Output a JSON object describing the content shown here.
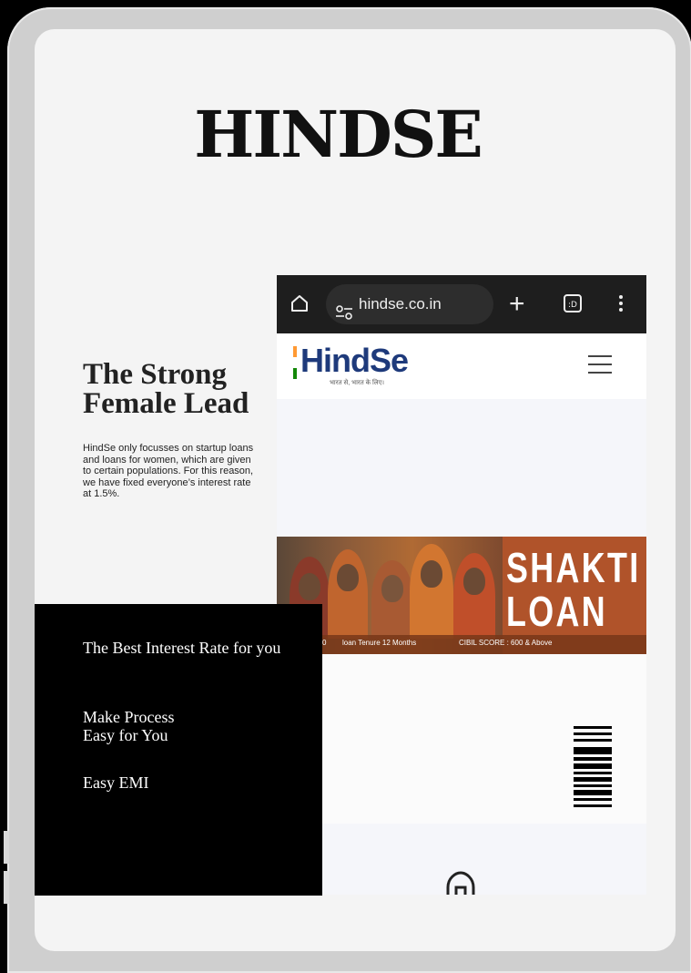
{
  "brand": {
    "title": "HINDSE"
  },
  "hero": {
    "headline_line1": "The Strong",
    "headline_line2": "Female Lead",
    "description": "HindSe only focusses on startup loans and loans for women, which are given to certain populations. For this reason, we have fixed everyone’s interest rate at 1.5%."
  },
  "features": {
    "item1": "The Best Interest Rate for you",
    "item2_line1": "Make Process",
    "item2_line2": "Easy for You",
    "item3": "Easy EMI"
  },
  "browser": {
    "url": "hindse.co.in",
    "icons": [
      "home-icon",
      "tune-icon",
      "plus-icon",
      "tab-switcher-icon",
      "more-vert-icon"
    ]
  },
  "site": {
    "logo_text": "HindSe",
    "logo_tagline": "भारत से, भारत के लिए।",
    "menu_icon": "hamburger-icon"
  },
  "banner": {
    "title_line1": "SHAKTI",
    "title_line2": "LOAN",
    "strip_items": [
      "0",
      "loan Tenure 12 Months",
      "CIBIL SCORE : 600 & Above"
    ]
  },
  "colors": {
    "background": "#000000",
    "tablet_frame": "#cfcfcf",
    "screen": "#f4f4f4",
    "browser_bar": "#1e1e1e",
    "logo_blue": "#1e3a7b",
    "banner_rust": "#b0532a",
    "flag_saffron": "#ff9933",
    "flag_green": "#138808"
  }
}
